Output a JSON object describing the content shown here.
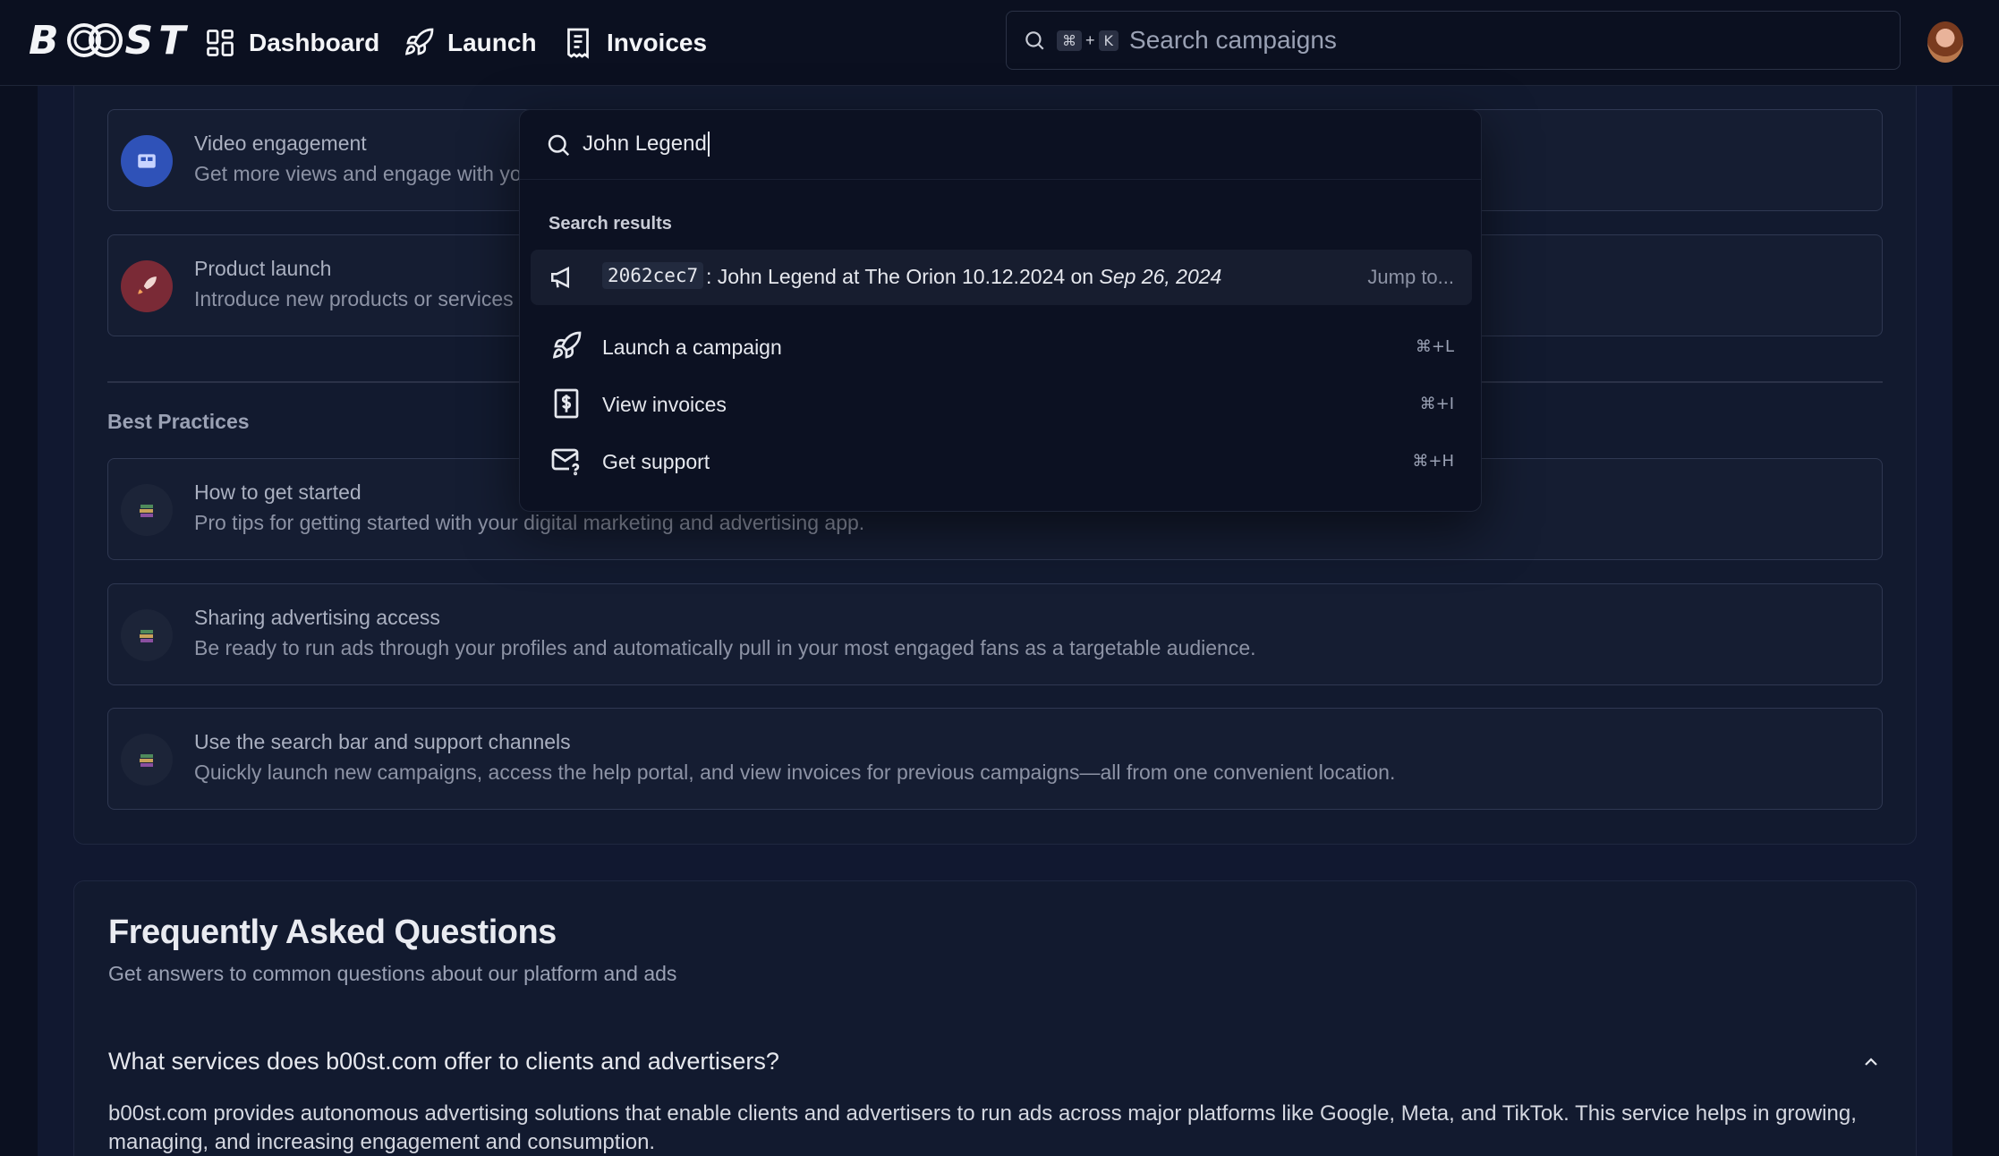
{
  "nav": {
    "logo_text": "BOOST",
    "items": [
      {
        "label": "Dashboard",
        "icon": "grid-icon"
      },
      {
        "label": "Launch",
        "icon": "rocket-icon"
      },
      {
        "label": "Invoices",
        "icon": "receipt-icon"
      }
    ],
    "search": {
      "shortcut_cmd": "⌘",
      "shortcut_plus": "+",
      "shortcut_key": "K",
      "placeholder": "Search campaigns"
    }
  },
  "cards_top": [
    {
      "title": "Video engagement",
      "desc": "Get more views and engage with yo",
      "icon": "video-icon"
    },
    {
      "title": "Product launch",
      "desc": "Introduce new products or services",
      "icon": "rocket-badge-icon"
    }
  ],
  "best_practices": {
    "title": "Best Practices",
    "items": [
      {
        "title": "How to get started",
        "desc": "Pro tips for getting started with your digital marketing and advertising app."
      },
      {
        "title": "Sharing advertising access",
        "desc": "Be ready to run ads through your profiles and automatically pull in your most engaged fans as a targetable audience."
      },
      {
        "title": "Use the search bar and support channels",
        "desc": "Quickly launch new campaigns, access the help portal, and view invoices for previous campaigns—all from one convenient location."
      }
    ]
  },
  "faq": {
    "title": "Frequently Asked Questions",
    "subtitle": "Get answers to common questions about our platform and ads",
    "question": "What services does b00st.com offer to clients and advertisers?",
    "answer": "b00st.com provides autonomous advertising solutions that enable clients and advertisers to run ads across major platforms like Google, Meta, and TikTok. This service helps in growing, managing, and increasing engagement and consumption."
  },
  "palette": {
    "query": "John Legend",
    "heading": "Search results",
    "result": {
      "code": "2062cec7",
      "text": ": John Legend at The Orion 10.12.2024 on ",
      "date": "Sep 26, 2024",
      "jump": "Jump to..."
    },
    "commands": [
      {
        "label": "Launch a campaign",
        "shortcut": "⌘+L",
        "icon": "rocket-icon"
      },
      {
        "label": "View invoices",
        "shortcut": "⌘+I",
        "icon": "invoice-dollar-icon"
      },
      {
        "label": "Get support",
        "shortcut": "⌘+H",
        "icon": "mail-help-icon"
      }
    ]
  }
}
